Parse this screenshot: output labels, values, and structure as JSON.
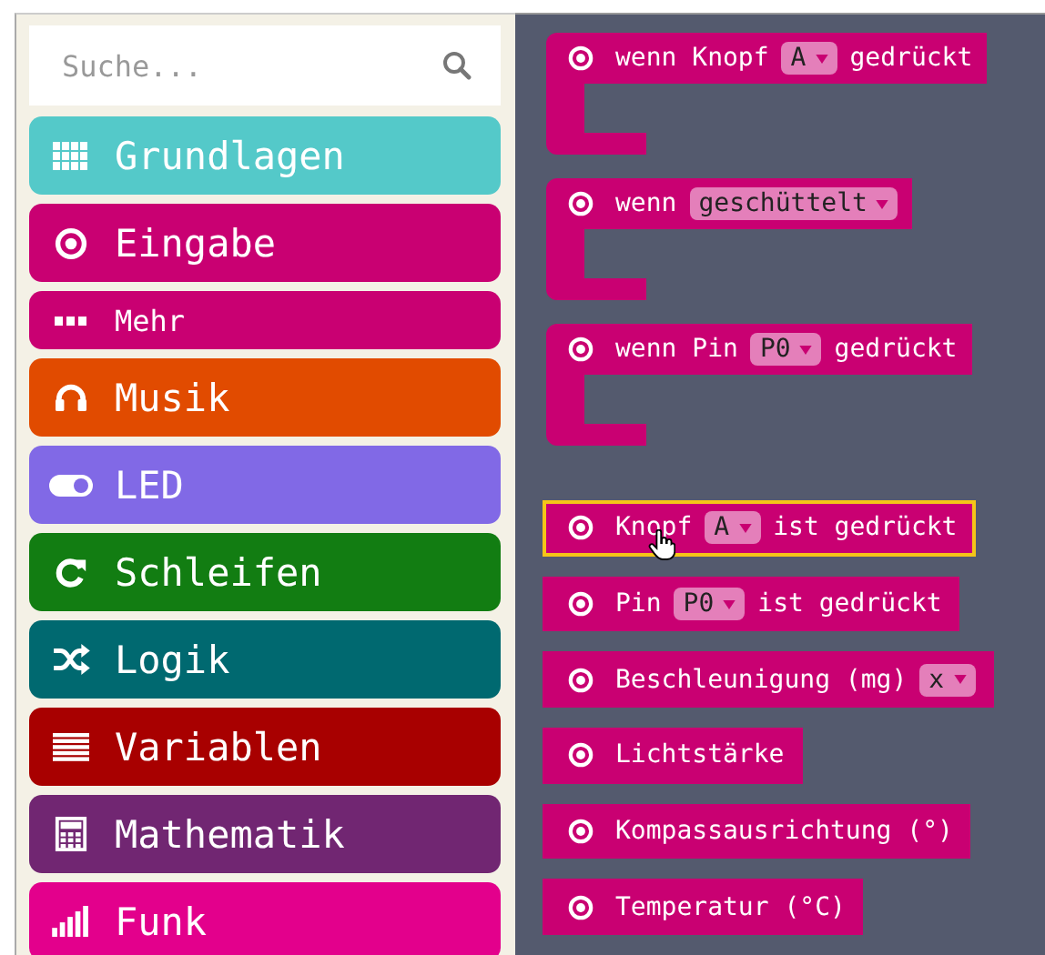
{
  "search": {
    "placeholder": "Suche..."
  },
  "categories": [
    {
      "label": "Grundlagen",
      "kind": "main",
      "color": "#54c9c9"
    },
    {
      "label": "Eingabe",
      "kind": "main",
      "color": "#c90072"
    },
    {
      "label": "Mehr",
      "kind": "sub",
      "color": "#c90072"
    },
    {
      "label": "Musik",
      "kind": "main",
      "color": "#e14b00"
    },
    {
      "label": "LED",
      "kind": "main",
      "color": "#8169e6"
    },
    {
      "label": "Schleifen",
      "kind": "main",
      "color": "#127d12"
    },
    {
      "label": "Logik",
      "kind": "main",
      "color": "#006970"
    },
    {
      "label": "Variablen",
      "kind": "main",
      "color": "#a80000"
    },
    {
      "label": "Mathematik",
      "kind": "main",
      "color": "#712672"
    },
    {
      "label": "Funk",
      "kind": "main",
      "color": "#e3008c"
    }
  ],
  "blocks": [
    {
      "kind": "event",
      "parts": [
        {
          "kind": "text",
          "text": "wenn Knopf"
        },
        {
          "kind": "dropdown",
          "text": "A"
        },
        {
          "kind": "text",
          "text": "gedrückt"
        }
      ]
    },
    {
      "kind": "event",
      "parts": [
        {
          "kind": "text",
          "text": "wenn"
        },
        {
          "kind": "dropdown",
          "text": "geschüttelt"
        }
      ]
    },
    {
      "kind": "event",
      "parts": [
        {
          "kind": "text",
          "text": "wenn Pin"
        },
        {
          "kind": "dropdown",
          "text": "P0"
        },
        {
          "kind": "text",
          "text": "gedrückt"
        }
      ]
    },
    {
      "kind": "reporter",
      "selected": true,
      "parts": [
        {
          "kind": "text",
          "text": "Knopf"
        },
        {
          "kind": "dropdown",
          "text": "A"
        },
        {
          "kind": "text",
          "text": "ist gedrückt"
        }
      ]
    },
    {
      "kind": "reporter",
      "selected": false,
      "parts": [
        {
          "kind": "text",
          "text": "Pin"
        },
        {
          "kind": "dropdown",
          "text": "P0"
        },
        {
          "kind": "text",
          "text": "ist gedrückt"
        }
      ]
    },
    {
      "kind": "reporter",
      "selected": false,
      "parts": [
        {
          "kind": "text",
          "text": "Beschleunigung (mg)"
        },
        {
          "kind": "dropdown",
          "text": "x"
        }
      ]
    },
    {
      "kind": "reporter",
      "selected": false,
      "parts": [
        {
          "kind": "text",
          "text": "Lichtstärke"
        }
      ]
    },
    {
      "kind": "reporter",
      "selected": false,
      "parts": [
        {
          "kind": "text",
          "text": "Kompassausrichtung (°)"
        }
      ]
    },
    {
      "kind": "reporter",
      "selected": false,
      "parts": [
        {
          "kind": "text",
          "text": "Temperatur (°C)"
        }
      ]
    }
  ]
}
